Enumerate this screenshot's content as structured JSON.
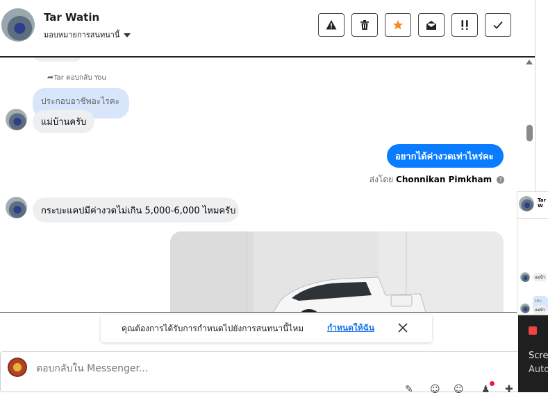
{
  "header": {
    "contact_name": "Tar Watin",
    "assign_label": "มอบหมายการสนทนานี้",
    "toolbar": [
      {
        "icon": "warning-icon"
      },
      {
        "icon": "trash-icon"
      },
      {
        "icon": "star-icon",
        "color": "#f28b1f"
      },
      {
        "icon": "envelope-open-icon"
      },
      {
        "icon": "priority-icon"
      },
      {
        "icon": "check-icon"
      }
    ]
  },
  "thread": {
    "reply_label": "Tar ตอบกลับ You",
    "quoted_text": "ประกอบอาชีพอะไรคะ",
    "reply_text": "แม่บ้านครับ",
    "outgoing_text": "อยากได้ค่างวดเท่าไหร่คะ",
    "sent_by_prefix": "ส่งโดย",
    "sent_by_name": "Chonnikan Pimkham",
    "incoming_text": "กระบะแคปมีค่างวดไม่เกิน 5,000-6,000 ไหมครับ"
  },
  "notice": {
    "text": "คุณต้องการได้รับการกำหนดไปยังการสนทนานี้ไหม",
    "link": "กำหนดให้ฉัน"
  },
  "composer": {
    "placeholder": "ตอบกลับใน Messenger..."
  },
  "side_panel": {
    "name_snippet": "Tar W",
    "msg1": "แม่บ้า",
    "msg2": "ประกอ",
    "msg3": "แม่บ้า"
  },
  "dark_panel": {
    "line1": "Scre",
    "line2": "Auto"
  },
  "colors": {
    "outgoing_bubble": "#0a7cff",
    "incoming_bubble": "#eeeff1",
    "quote_bubble": "#d8e6fb",
    "link": "#1a73e8"
  }
}
